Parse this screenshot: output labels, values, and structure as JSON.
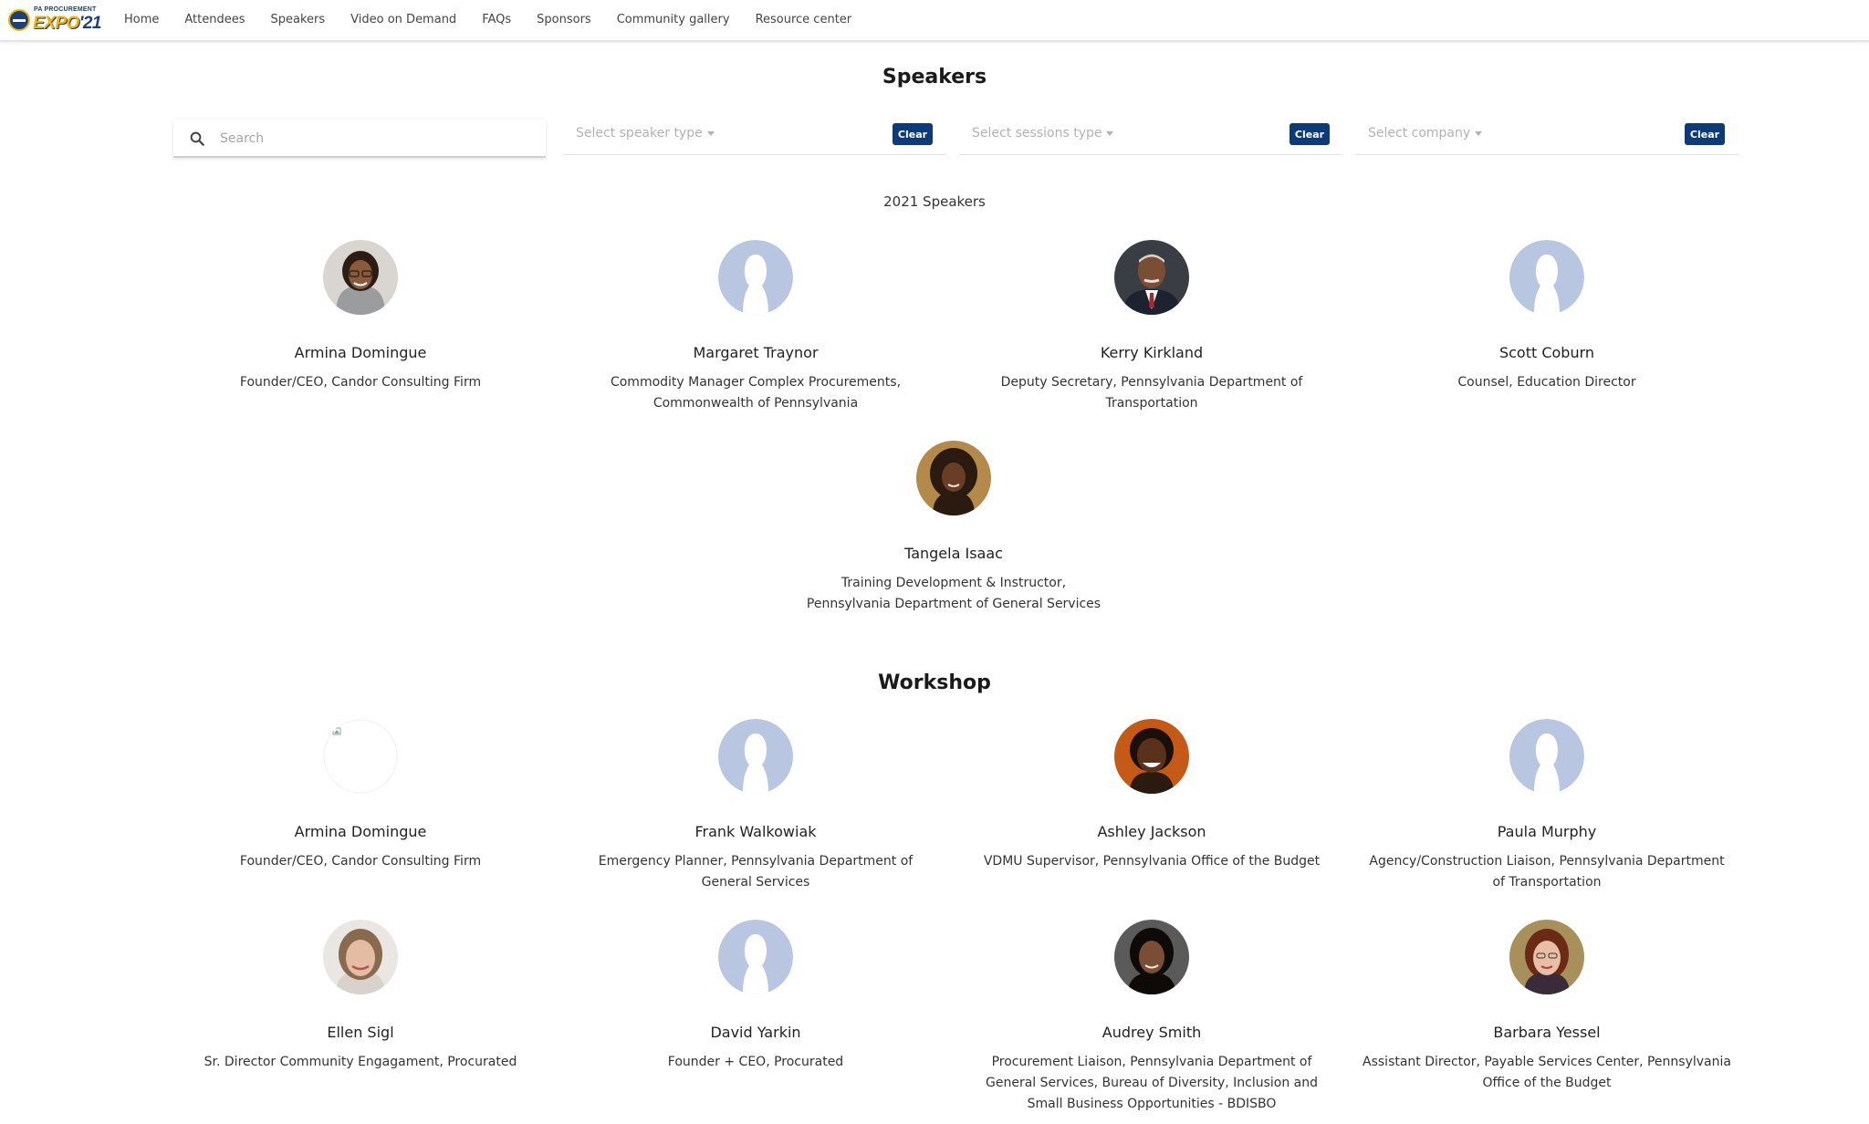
{
  "app": {
    "logo_top": "PA PROCUREMENT",
    "logo_main": "EXPO",
    "logo_year": "'21"
  },
  "nav": {
    "items": [
      {
        "label": "Home"
      },
      {
        "label": "Attendees"
      },
      {
        "label": "Speakers"
      },
      {
        "label": "Video on Demand"
      },
      {
        "label": "FAQs"
      },
      {
        "label": "Sponsors"
      },
      {
        "label": "Community gallery"
      },
      {
        "label": "Resource center"
      }
    ]
  },
  "page": {
    "title": "Speakers"
  },
  "filters": {
    "search_placeholder": "Search",
    "speaker_type": "Select speaker type",
    "sessions_type": "Select sessions type",
    "company": "Select company",
    "clear_label": "Clear"
  },
  "sections": {
    "speakers_2021": "2021 Speakers",
    "workshop": "Workshop"
  },
  "speakers_2021": [
    {
      "name": "Armina Domingue",
      "title": "Founder/CEO, Candor Consulting Firm",
      "avatar": "photo-woman-glasses"
    },
    {
      "name": "Margaret Traynor",
      "title": "Commodity Manager Complex Procurements, Commonwealth of Pennsylvania",
      "avatar": "placeholder"
    },
    {
      "name": "Kerry Kirkland",
      "title": "Deputy Secretary, Pennsylvania Department of Transportation",
      "avatar": "photo-man-suit"
    },
    {
      "name": "Scott Coburn",
      "title": "Counsel, Education Director",
      "avatar": "placeholder"
    },
    {
      "name": "Tangela Isaac",
      "title": "Training Development & Instructor, Pennsylvania Department of General Services",
      "avatar": "photo-woman-curly"
    }
  ],
  "workshop": [
    {
      "name": "Armina Domingue",
      "title": "Founder/CEO, Candor Consulting Firm",
      "avatar": "broken-image"
    },
    {
      "name": "Frank Walkowiak",
      "title": "Emergency Planner, Pennsylvania Department of General Services",
      "avatar": "placeholder"
    },
    {
      "name": "Ashley Jackson",
      "title": "VDMU Supervisor, Pennsylvania Office of the Budget",
      "avatar": "photo-woman-smile"
    },
    {
      "name": "Paula Murphy",
      "title": "Agency/Construction Liaison, Pennsylvania Department of Transportation",
      "avatar": "placeholder"
    },
    {
      "name": "Ellen Sigl",
      "title": "Sr. Director Community Engagament, Procurated",
      "avatar": "photo-woman-blonde"
    },
    {
      "name": "David Yarkin",
      "title": "Founder + CEO, Procurated",
      "avatar": "placeholder"
    },
    {
      "name": "Audrey Smith",
      "title": "Procurement Liaison, Pennsylvania Department of General Services, Bureau of Diversity, Inclusion and Small Business Opportunities - BDISBO",
      "avatar": "photo-woman-dark-hair"
    },
    {
      "name": "Barbara Yessel",
      "title": "Assistant Director, Payable Services Center, Pennsylvania Office of the Budget",
      "avatar": "photo-woman-red-hair"
    }
  ],
  "colors": {
    "accent": "#0d3b7a",
    "placeholder_avatar": "#b9c6e2",
    "logo_gold": "#f4b400",
    "logo_navy": "#1d3f7a"
  }
}
